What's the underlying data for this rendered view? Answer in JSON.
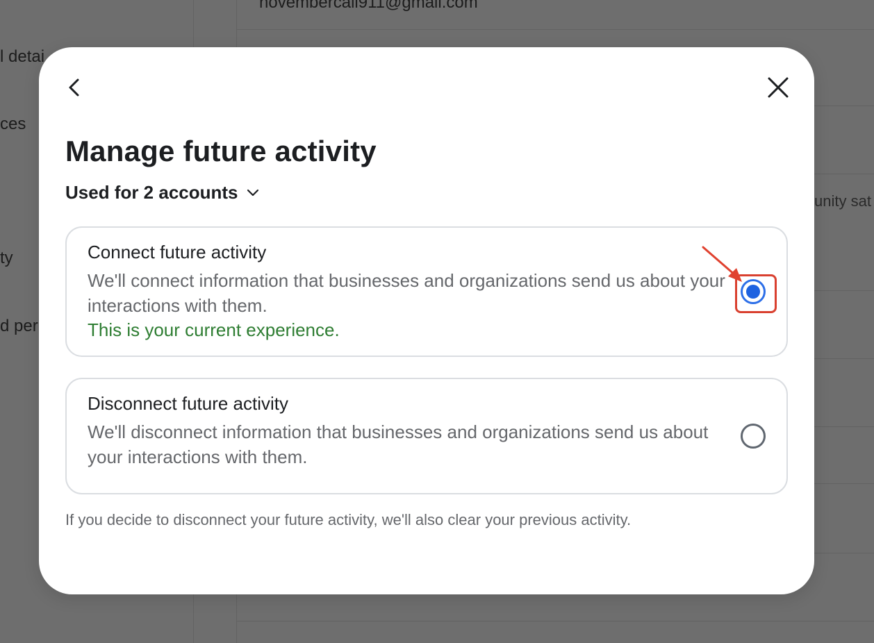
{
  "background": {
    "sidebar_items": [
      {
        "label": "l detai"
      },
      {
        "label": "ces"
      },
      {
        "label": "ty"
      },
      {
        "label": "d per"
      }
    ],
    "email": "novembercall911@gmail.com",
    "right_text": "unity sat"
  },
  "modal": {
    "back_icon": "chevron-left-icon",
    "close_icon": "close-icon",
    "title": "Manage future activity",
    "accounts_label": "Used for 2 accounts",
    "accounts_icon": "chevron-down-icon",
    "options": [
      {
        "title": "Connect future activity",
        "description": "We'll connect information that businesses and organizations send us about your interactions with them.",
        "status": "This is your current experience.",
        "selected": true
      },
      {
        "title": "Disconnect future activity",
        "description": "We'll disconnect information that businesses and organizations send us about your interactions with them.",
        "selected": false
      }
    ],
    "footnote": "If you decide to disconnect your future activity, we'll also clear your previous activity."
  },
  "colors": {
    "accent": "#1e62e0",
    "status_green": "#2e7d32",
    "annotation_red": "#d9402f"
  }
}
